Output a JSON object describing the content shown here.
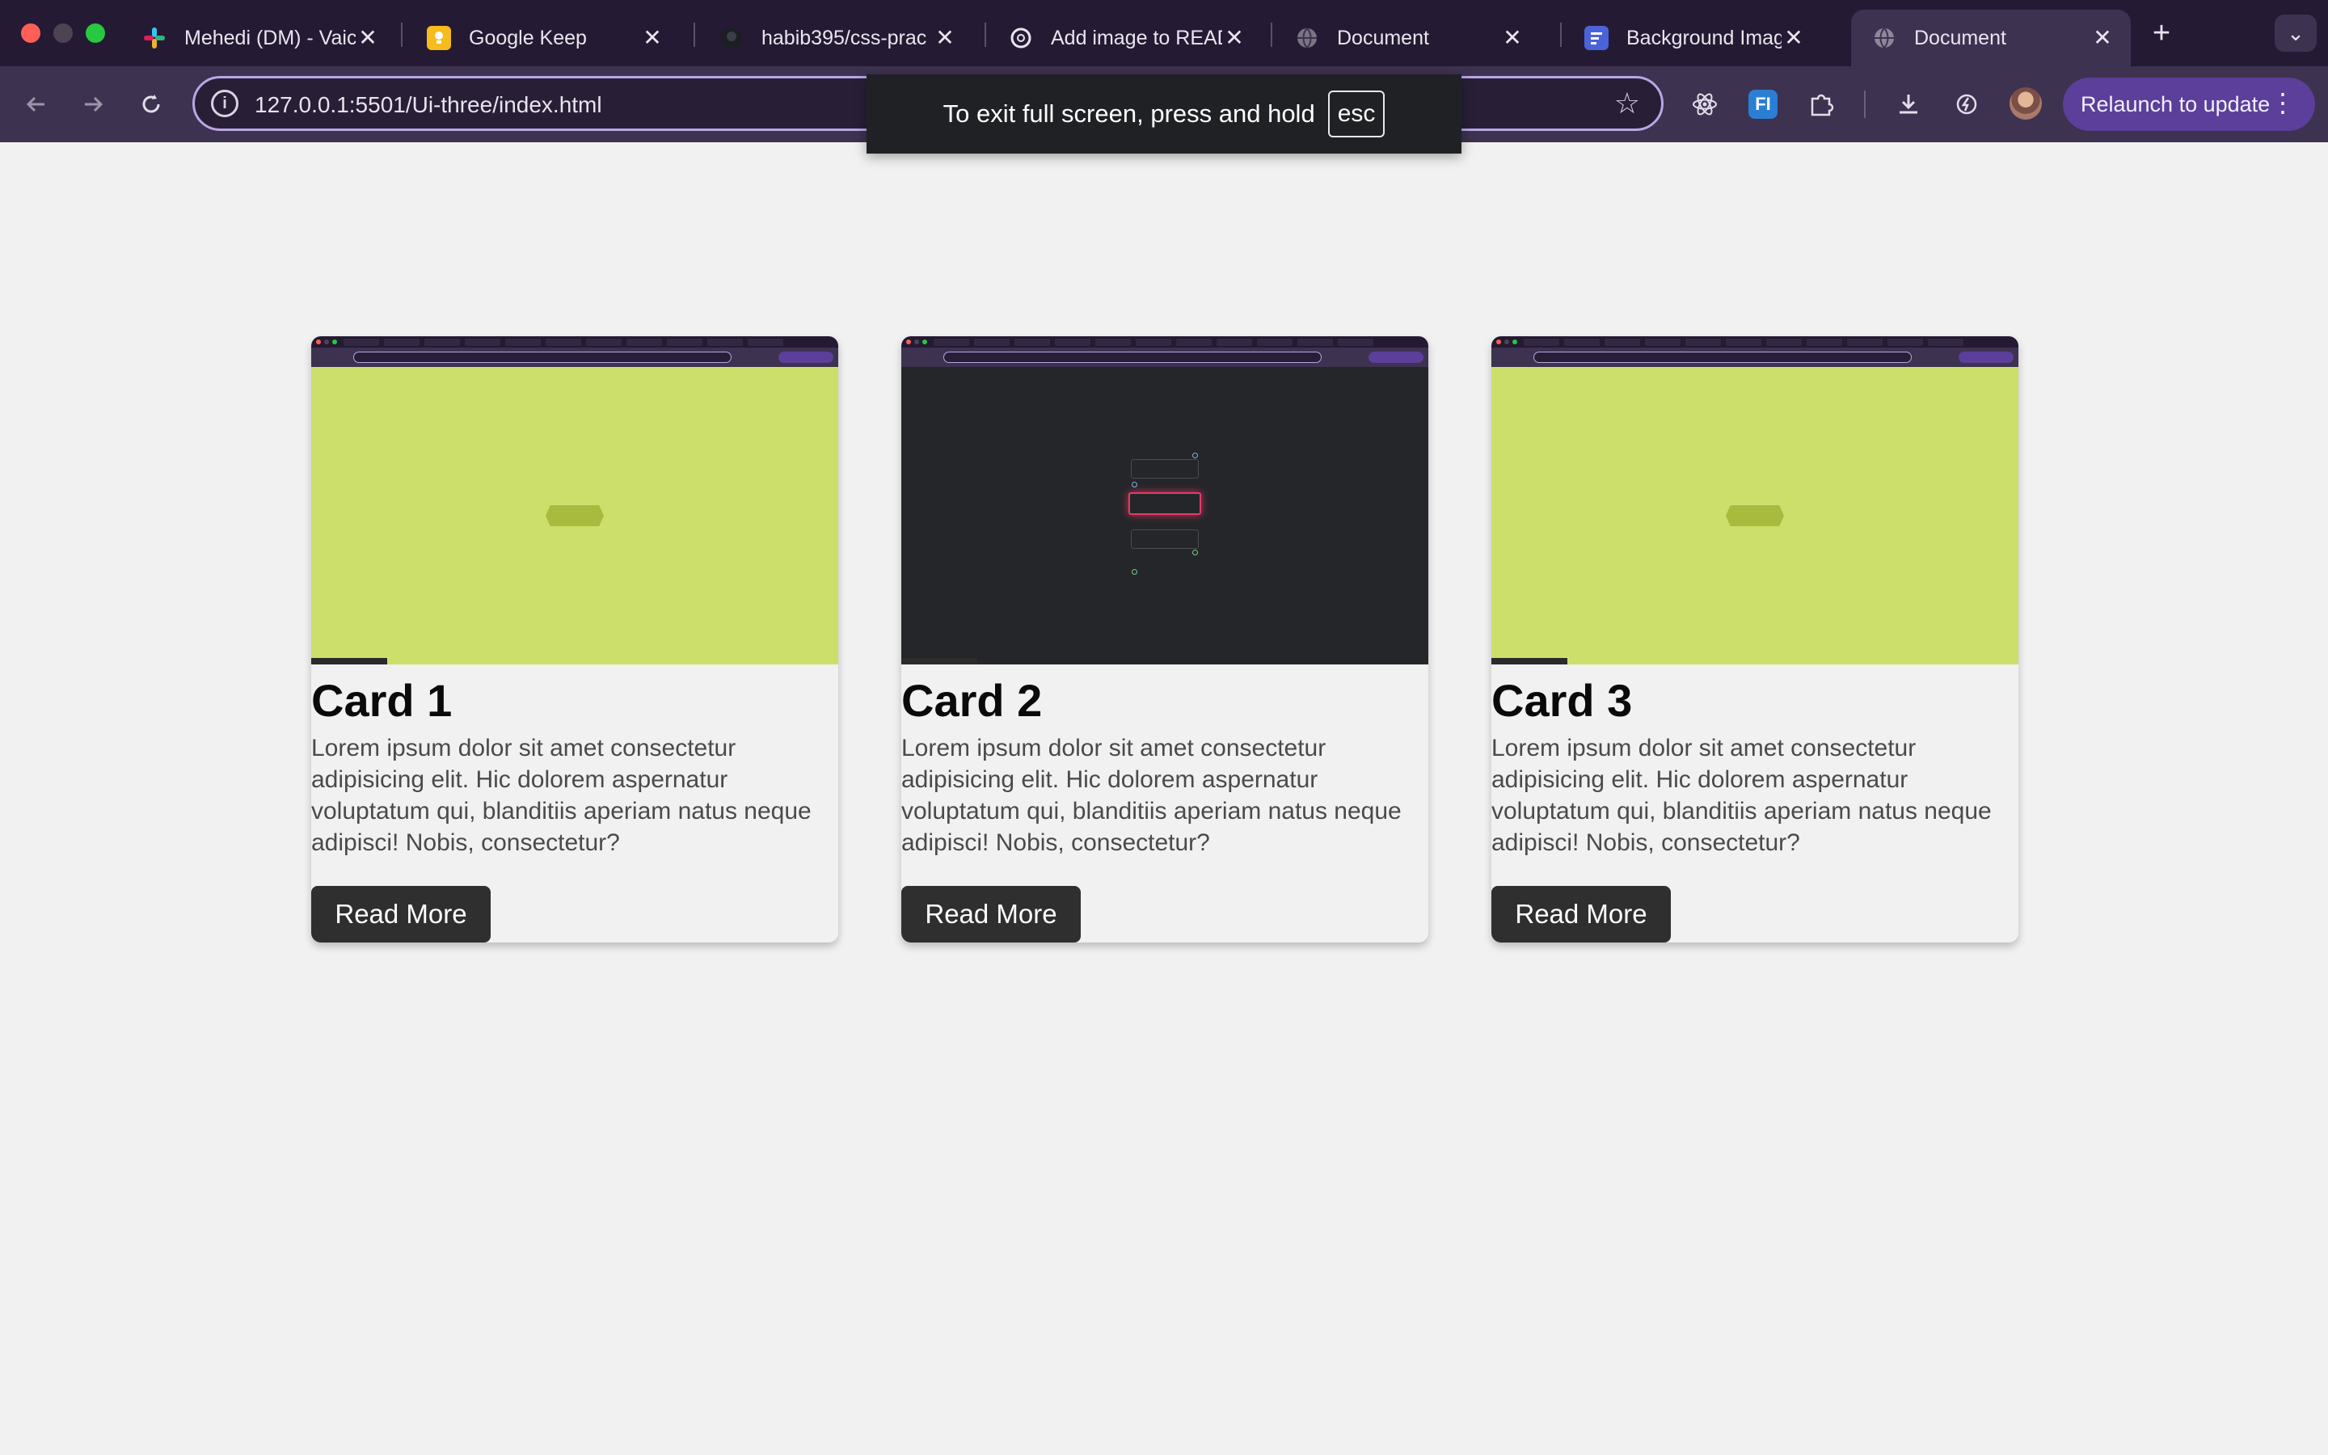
{
  "browser": {
    "tabs": [
      {
        "title": "Mehedi (DM) - Vaic",
        "icon": "slack-icon",
        "active": false
      },
      {
        "title": "Google Keep",
        "icon": "keep-icon",
        "active": false
      },
      {
        "title": "habib395/css-prac",
        "icon": "github-icon",
        "active": false
      },
      {
        "title": "Add image to READ",
        "icon": "openai-icon",
        "active": false
      },
      {
        "title": "Document",
        "icon": "globe-icon",
        "active": false
      },
      {
        "title": "Background Image",
        "icon": "docs-icon",
        "active": false
      },
      {
        "title": "Document",
        "icon": "globe-icon",
        "active": true
      }
    ],
    "close_glyph": "✕",
    "new_tab_glyph": "+",
    "address_bar": {
      "url": "127.0.0.1:5501/Ui-three/index.html"
    },
    "relaunch_label": "Relaunch to update",
    "fullscreen_notice": {
      "text": "To exit full screen, press and hold",
      "key": "esc"
    },
    "colors": {
      "tabbar": "#241a33",
      "toolbar": "#3d3250",
      "relaunch": "#5b3f9a"
    }
  },
  "page": {
    "cards": [
      {
        "title": "Card 1",
        "text": "Lorem ipsum dolor sit amet consectetur adipisicing elit. Hic dolorem aspernatur voluptatum qui, blanditiis aperiam natus neque adipisci! Nobis, consectetur?",
        "button_label": "Read More",
        "image_theme": "lime"
      },
      {
        "title": "Card 2",
        "text": "Lorem ipsum dolor sit amet consectetur adipisicing elit. Hic dolorem aspernatur voluptatum qui, blanditiis aperiam natus neque adipisci! Nobis, consectetur?",
        "button_label": "Read More",
        "image_theme": "dark"
      },
      {
        "title": "Card 3",
        "text": "Lorem ipsum dolor sit amet consectetur adipisicing elit. Hic dolorem aspernatur voluptatum qui, blanditiis aperiam natus neque adipisci! Nobis, consectetur?",
        "button_label": "Read More",
        "image_theme": "lime"
      }
    ],
    "colors": {
      "background": "#f1f1f1",
      "button": "#2f2f2f",
      "lime": "#cddf6b",
      "dark": "#25262a"
    }
  }
}
